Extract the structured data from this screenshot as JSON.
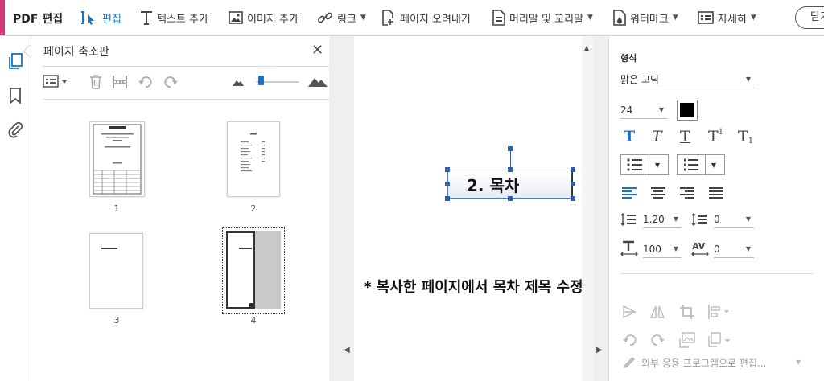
{
  "toolbar": {
    "title": "PDF 편집",
    "items": [
      {
        "label": "편집",
        "icon": "edit-cursor-icon"
      },
      {
        "label": "텍스트 추가",
        "icon": "text-icon"
      },
      {
        "label": "이미지 추가",
        "icon": "image-icon"
      },
      {
        "label": "링크",
        "icon": "link-icon"
      },
      {
        "label": "페이지 오려내기",
        "icon": "crop-page-icon"
      },
      {
        "label": "머리말 및 꼬리말",
        "icon": "header-footer-icon"
      },
      {
        "label": "워터마크",
        "icon": "watermark-icon"
      },
      {
        "label": "자세히",
        "icon": "more-icon"
      }
    ],
    "close_label": "닫기",
    "accent_color": "#d6397b",
    "active_color": "#1a73c8"
  },
  "thumbnails": {
    "title": "페이지 축소판",
    "pages": [
      "1",
      "2",
      "3",
      "4"
    ]
  },
  "canvas": {
    "textbox_text": "2. 목차",
    "annotation": "* 복사한 페이지에서 목차 제목 수정"
  },
  "properties": {
    "section_label": "형식",
    "font_family": "맑은 고딕",
    "font_size": "24",
    "text_color": "#000000",
    "line_spacing": "1.20",
    "paragraph_spacing": "0",
    "horizontal_scale": "100",
    "char_spacing": "0",
    "external_edit_label": "외부 응용 프로그램으로 편집..."
  }
}
